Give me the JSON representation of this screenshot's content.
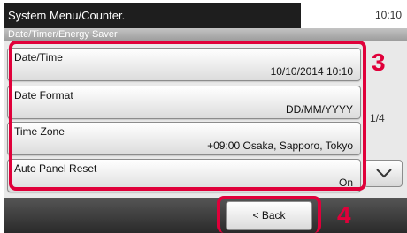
{
  "header": {
    "title": "System Menu/Counter.",
    "time": "10:10"
  },
  "breadcrumb": "Date/Timer/Energy Saver",
  "items": [
    {
      "label": "Date/Time",
      "value": "10/10/2014 10:10"
    },
    {
      "label": "Date Format",
      "value": "DD/MM/YYYY"
    },
    {
      "label": "Time Zone",
      "value": "+09:00 Osaka, Sapporo, Tokyo"
    },
    {
      "label": "Auto Panel Reset",
      "value": "On"
    }
  ],
  "pagination": {
    "indicator": "1/4",
    "down_icon": "chevron-down-icon"
  },
  "footer": {
    "back_label": "< Back"
  },
  "callouts": {
    "list": "3",
    "back": "4"
  },
  "colors": {
    "callout": "#e0003a",
    "title_bar": "#1e1e1e",
    "bottom_bar": "#2a2a2a"
  }
}
